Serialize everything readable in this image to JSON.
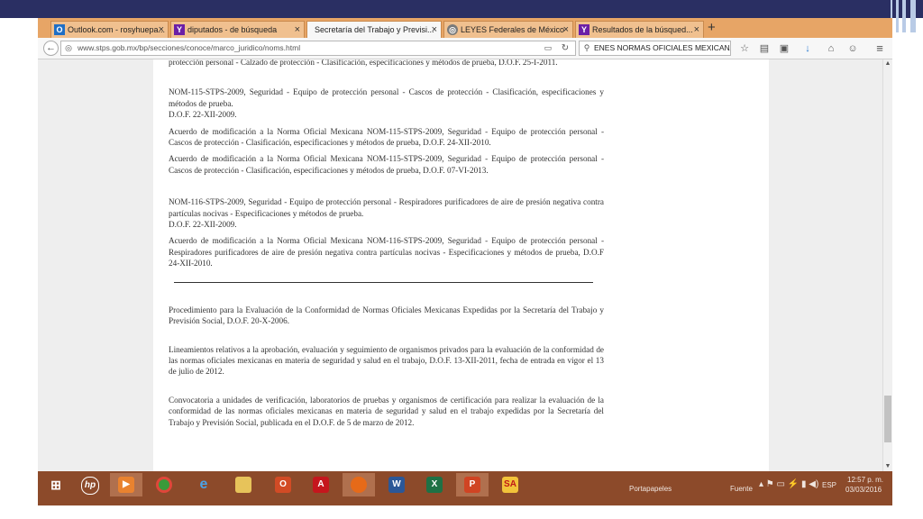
{
  "tabs": [
    {
      "label": "Outlook.com - rosyhuepa...",
      "icon": "outlook-icon",
      "active": false
    },
    {
      "label": "diputados - de búsqueda",
      "icon": "yahoo-icon",
      "active": false
    },
    {
      "label": "Secretaría del Trabajo y Previsi...",
      "icon": "none",
      "active": true
    },
    {
      "label": "LEYES Federales de México",
      "icon": "globe-icon",
      "active": false
    },
    {
      "label": "Resultados de la búsqued...",
      "icon": "yahoo-icon",
      "active": false
    }
  ],
  "newtab_symbol": "+",
  "urlbar": {
    "url": "www.stps.gob.mx/bp/secciones/conoce/marco_juridico/noms.html"
  },
  "searchbar": {
    "value": "ENES NORMAS OFICIALES MEXICANAS →"
  },
  "document": {
    "p0": "protección personal - Calzado de protección - Clasificación, especificaciones y métodos de prueba, D.O.F. 25-I-2011.",
    "nom115_title": "NOM-115-STPS-2009, Seguridad - Equipo de protección personal - Cascos de protección - Clasificación, especificaciones y métodos de prueba.",
    "nom115_dof": "D.O.F. 22-XII-2009.",
    "nom115_mod1": "Acuerdo de modificación a la Norma Oficial Mexicana NOM-115-STPS-2009, Seguridad - Equipo de protección personal - Cascos de protección - Clasificación, especificaciones y métodos de prueba, D.O.F. 24-XII-2010.",
    "nom115_mod2": "Acuerdo de modificación a la Norma Oficial Mexicana NOM-115-STPS-2009, Seguridad - Equipo de protección personal - Cascos de protección - Clasificación, especificaciones y métodos de prueba, D.O.F. 07-VI-2013.",
    "nom116_title": "NOM-116-STPS-2009, Seguridad - Equipo de protección personal - Respiradores purificadores de aire de presión negativa contra partículas nocivas - Especificaciones y métodos de prueba.",
    "nom116_dof": "D.O.F. 22-XII-2009.",
    "nom116_mod1": "Acuerdo de modificación a la Norma Oficial Mexicana NOM-116-STPS-2009, Seguridad - Equipo de protección personal - Respiradores purificadores de aire de presión negativa contra partículas nocivas - Especificaciones y métodos de prueba, D.O.F 24-XII-2010.",
    "procedimiento": "Procedimiento para la Evaluación de la Conformidad de Normas Oficiales Mexicanas Expedidas por la Secretaría del Trabajo y Previsión Social, D.O.F. 20-X-2006.",
    "lineamientos": "Lineamientos relativos a la aprobación, evaluación y seguimiento de organismos privados para la evaluación de la conformidad de las normas oficiales mexicanas en materia de seguridad y salud en el trabajo, D.O.F. 13-XII-2011, fecha de entrada en vigor el 13 de julio de 2012.",
    "convocatoria": "Convocatoria a unidades de verificación, laboratorios de pruebas y organismos de certificación para realizar la evaluación de la conformidad de las normas oficiales mexicanas en materia de seguridad y salud en el trabajo expedidas por la Secretaría del Trabajo y Previsión Social, publicada en el D.O.F. de 5 de marzo de 2012."
  },
  "taskbar": {
    "portapapeles": "Portapapeles",
    "fuente": "Fuente",
    "language": "ESP",
    "time": "12:57 p. m.",
    "date": "03/03/2016"
  },
  "colors": {
    "taskbar": "#8c4a2a",
    "tabstrip": "#e7a566",
    "slide_bar": "#2a2f63"
  }
}
